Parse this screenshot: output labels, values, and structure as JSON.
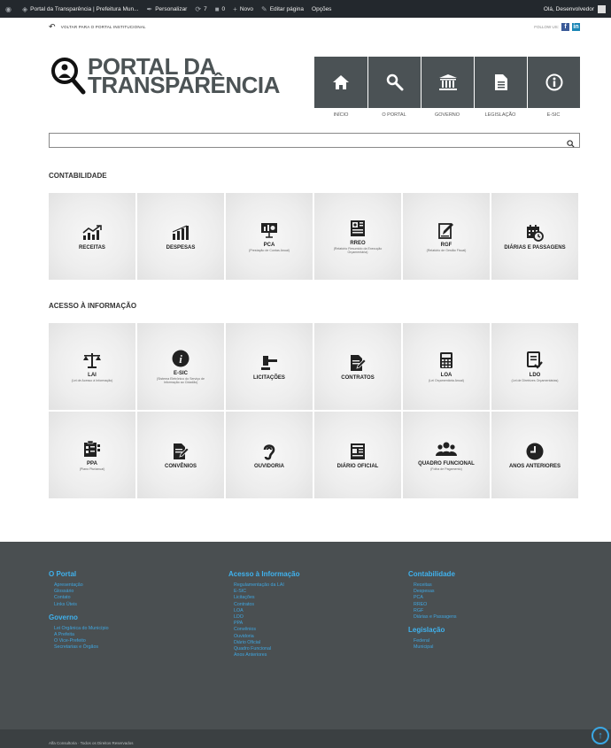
{
  "adminbar": {
    "site": "Portal da Transparência | Prefeitura Mun...",
    "customize": "Personalizar",
    "updates": "7",
    "comments": "0",
    "new": "Novo",
    "edit": "Editar página",
    "options": "Opções",
    "greeting": "Olá, Desenvolvedor"
  },
  "topstrip": {
    "back": "VOLTAR PARA O PORTAL INSTITUCIONAL",
    "follow": "FOLLOW US:",
    "fb": "f",
    "li": "in"
  },
  "logo": {
    "line1": "PORTAL DA",
    "line2": "TRANSPARÊNCIA"
  },
  "nav": [
    {
      "label": "INÍCIO",
      "icon": "home-icon"
    },
    {
      "label": "O PORTAL",
      "icon": "search-icon"
    },
    {
      "label": "GOVERNO",
      "icon": "government-building-icon"
    },
    {
      "label": "LEGISLAÇÃO",
      "icon": "document-icon"
    },
    {
      "label": "E-SIC",
      "icon": "info-icon"
    }
  ],
  "search": {
    "placeholder": ""
  },
  "sections": {
    "contabilidade": "CONTABILIDADE",
    "acesso": "ACESSO À INFORMAÇÃO"
  },
  "contabilidade": [
    {
      "label": "RECEITAS",
      "sub": "",
      "icon": "rising-chart-icon"
    },
    {
      "label": "DESPESAS",
      "sub": "",
      "icon": "bar-chart-icon"
    },
    {
      "label": "PCA",
      "sub": "(Prestação de Contas Anual)",
      "icon": "presentation-icon"
    },
    {
      "label": "RREO",
      "sub": "(Relatório Resumido da Execução Orçamentária)",
      "icon": "report-icon"
    },
    {
      "label": "RGF",
      "sub": "(Relatório de Gestão Fiscal)",
      "icon": "edit-document-icon"
    },
    {
      "label": "DIÁRIAS E PASSAGENS",
      "sub": "",
      "icon": "calendar-clock-icon"
    }
  ],
  "acesso1": [
    {
      "label": "LAI",
      "sub": "(Lei de Acesso à Informação)",
      "icon": "scales-icon"
    },
    {
      "label": "E-SIC",
      "sub": "(Sistema Eletrônico do Serviço de Informação ao Cidadão)",
      "icon": "info-circle-icon"
    },
    {
      "label": "LICITAÇÕES",
      "sub": "",
      "icon": "gavel-icon"
    },
    {
      "label": "CONTRATOS",
      "sub": "",
      "icon": "contract-icon"
    },
    {
      "label": "LOA",
      "sub": "(Lei Orçamentária Anual)",
      "icon": "calculator-icon"
    },
    {
      "label": "LDO",
      "sub": "(Lei de Diretrizes Orçamentárias)",
      "icon": "checklist-icon"
    }
  ],
  "acesso2": [
    {
      "label": "PPA",
      "sub": "(Plano Plurianual)",
      "icon": "clipboard-icon"
    },
    {
      "label": "CONVÊNIOS",
      "sub": "",
      "icon": "signed-document-icon"
    },
    {
      "label": "OUVIDORIA",
      "sub": "",
      "icon": "ear-icon"
    },
    {
      "label": "DIÁRIO OFICIAL",
      "sub": "",
      "icon": "newspaper-icon"
    },
    {
      "label": "QUADRO FUNCIONAL",
      "sub": "(Folha de Pagamento)",
      "icon": "people-icon"
    },
    {
      "label": "ANOS ANTERIORES",
      "sub": "",
      "icon": "clock-icon"
    }
  ],
  "footer": {
    "portal_title": "O Portal",
    "portal_links": [
      "Apresentação",
      "Glossário",
      "Contato",
      "Links Úteis"
    ],
    "governo_title": "Governo",
    "governo_links": [
      "Lei Orgânica do Município",
      "A Prefeita",
      "O Vice-Prefeito",
      "Secretarias e Órgãos"
    ],
    "acesso_title": "Acesso à Informação",
    "acesso_links": [
      "Regulamentação da LAI",
      "E-SIC",
      "Licitações",
      "Contratos",
      "LOA",
      "LDO",
      "PPA",
      "Convênios",
      "Ouvidoria",
      "Diário Oficial",
      "Quadro Funcional",
      "Anos Anteriores"
    ],
    "contab_title": "Contabilidade",
    "contab_links": [
      "Receitas",
      "Despesas",
      "PCA",
      "RREO",
      "RGF",
      "Diárias e Passagens"
    ],
    "legis_title": "Legislação",
    "legis_links": [
      "Federal",
      "Municipal"
    ],
    "copyright": "Alfa Consultoria · Todos os Direitos Reservados"
  }
}
